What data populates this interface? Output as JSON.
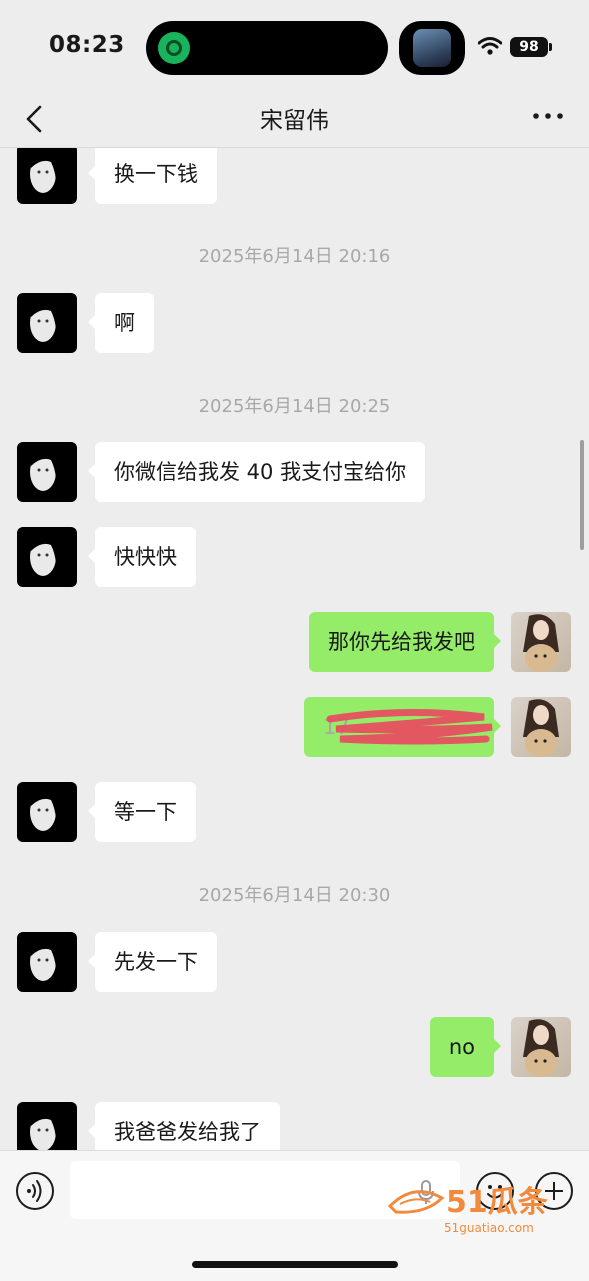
{
  "status_bar": {
    "time": "08:23",
    "battery": "98"
  },
  "nav": {
    "title": "宋留伟",
    "back_icon": "chevron-left-icon",
    "more_icon": "more-dots-icon"
  },
  "messages": [
    {
      "type": "left",
      "text": "换一下钱"
    },
    {
      "type": "time",
      "text": "2025年6月14日 20:16"
    },
    {
      "type": "left",
      "text": "啊"
    },
    {
      "type": "time",
      "text": "2025年6月14日 20:25"
    },
    {
      "type": "left",
      "text": "你微信给我发 40 我支付宝给你"
    },
    {
      "type": "left",
      "text": "快快快"
    },
    {
      "type": "right",
      "text": "那你先给我发吧"
    },
    {
      "type": "right",
      "text": "17",
      "redacted": true
    },
    {
      "type": "left",
      "text": "等一下"
    },
    {
      "type": "time",
      "text": "2025年6月14日 20:30"
    },
    {
      "type": "left",
      "text": "先发一下"
    },
    {
      "type": "right",
      "text": "no"
    },
    {
      "type": "left",
      "text": "我爸爸发给我了"
    }
  ],
  "input_bar": {
    "placeholder": ""
  },
  "watermark": {
    "main": "51瓜条",
    "sub": "51guatiao.com"
  },
  "colors": {
    "bubble_self": "#95ec69",
    "bubble_other": "#ffffff",
    "background": "#ededed",
    "watermark": "#f28a3c"
  }
}
